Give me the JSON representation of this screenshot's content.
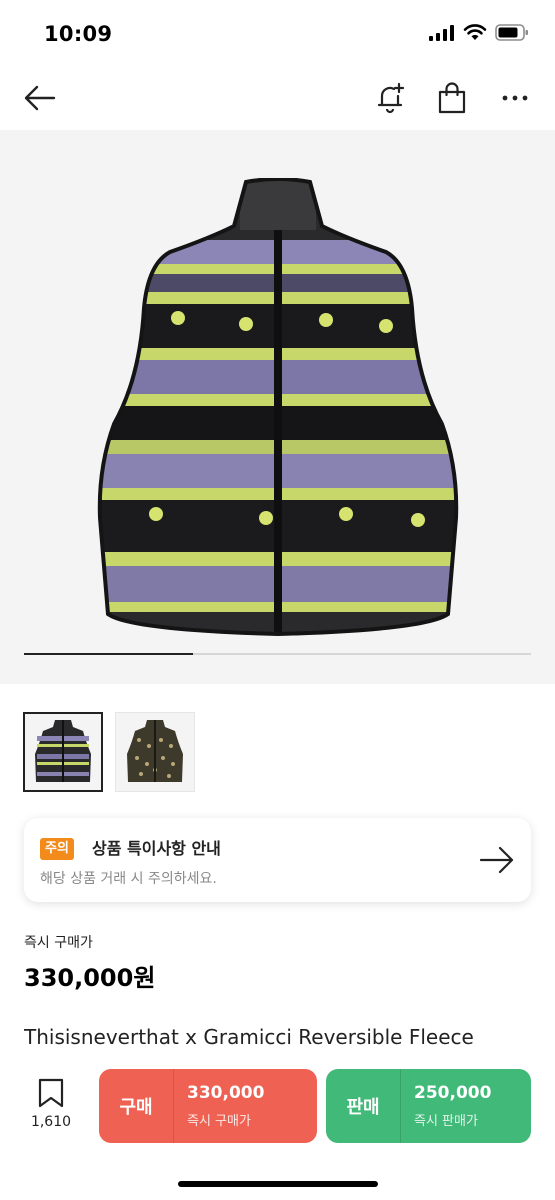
{
  "status_bar": {
    "time": "10:09"
  },
  "gallery": {
    "progress": 0.333,
    "thumbnails": [
      "thumb-1",
      "thumb-2"
    ]
  },
  "notice": {
    "badge": "주의",
    "title": "상품 특이사항 안내",
    "subtitle": "해당 상품 거래 시 주의하세요."
  },
  "price": {
    "label": "즉시 구매가",
    "value": "330,000원"
  },
  "product": {
    "title": "Thisisneverthat x Gramicci Reversible Fleece"
  },
  "bottom_bar": {
    "wish_count": "1,610",
    "buy": {
      "kind": "구매",
      "amount": "330,000",
      "caption": "즉시 구매가"
    },
    "sell": {
      "kind": "판매",
      "amount": "250,000",
      "caption": "즉시 판매가"
    }
  },
  "colors": {
    "buy": "#ef6253",
    "sell": "#41b979",
    "badge": "#f28b1c"
  }
}
